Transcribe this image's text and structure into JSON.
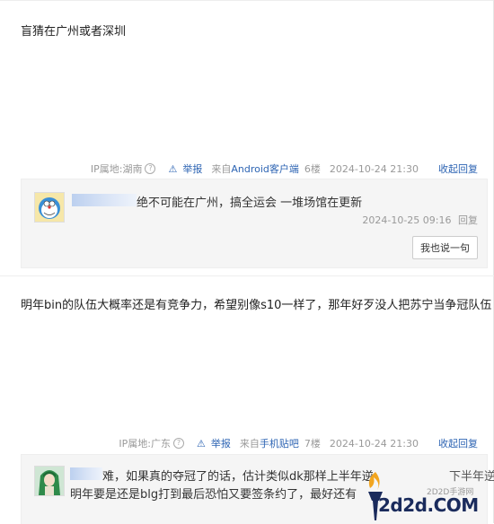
{
  "post1": {
    "text": "盲猜在广州或者深圳",
    "meta": {
      "ip_label": "IP属地:湖南",
      "hint": "?",
      "report": "举报",
      "client_prefix": "来自",
      "client": "Android客户端",
      "floor": "6楼",
      "time": "2024-10-24 21:30",
      "collapse": "收起回复"
    },
    "reply": {
      "text": "绝不可能在广州，搞全运会 一堆场馆在更新",
      "time": "2024-10-25 09:16",
      "reply_btn": "回复",
      "say_btn": "我也说一句"
    }
  },
  "post2": {
    "text": "明年bin的队伍大概率还是有竞争力，希望别像s10一样了，那年好歹没人把苏宁当争冠队伍",
    "meta": {
      "ip_label": "IP属地:广东",
      "hint": "?",
      "report": "举报",
      "client_prefix": "来自",
      "client": "手机贴吧",
      "floor": "7楼",
      "time": "2024-10-24 21:30",
      "collapse": "收起回复"
    },
    "reply": {
      "line1": "难，如果真的夺冠了的话，估计类似dk那样上半年逆",
      "line1_tail": "下半年逆",
      "line2": "明年要是还是blg打到最后恐怕又要签条约了，最好还有"
    }
  },
  "watermark": {
    "small": "2D2D手游网",
    "big": "2d2d.COM"
  },
  "colors": {
    "link": "#2d64b3",
    "meta": "#999999",
    "reply_bg": "#f5f5f5"
  }
}
